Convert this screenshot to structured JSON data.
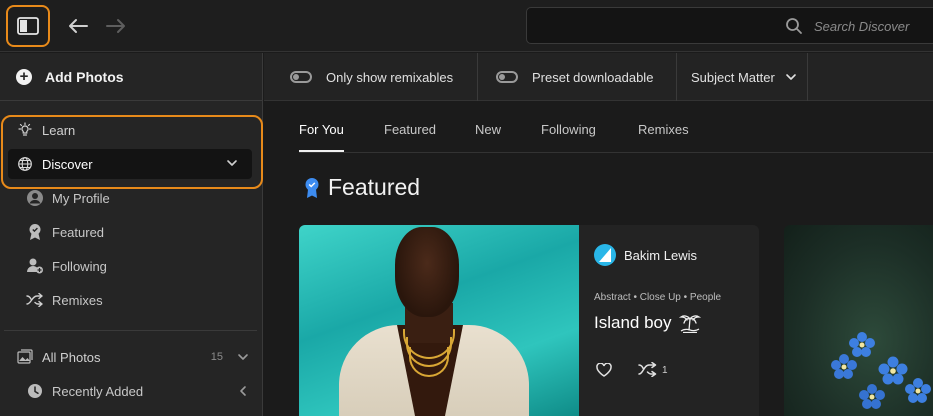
{
  "topbar": {
    "search_placeholder": "Search Discover"
  },
  "sidebar": {
    "add_photos": "Add Photos",
    "learn": "Learn",
    "discover": "Discover",
    "my_profile": "My Profile",
    "featured": "Featured",
    "following": "Following",
    "remixes": "Remixes",
    "all_photos": "All Photos",
    "all_photos_count": "15",
    "recently_added": "Recently Added"
  },
  "filters": {
    "remixables": "Only show remixables",
    "preset": "Preset downloadable",
    "subject": "Subject Matter"
  },
  "tabs": [
    "For You",
    "Featured",
    "New",
    "Following",
    "Remixes"
  ],
  "section_title": "Featured",
  "card": {
    "author": "Bakim Lewis",
    "tags": "Abstract • Close Up • People",
    "title": "Island boy",
    "remix_count": "1"
  },
  "colors": {
    "accent_highlight": "#e88a1a",
    "featured_badge": "#3d8cf0",
    "avatar": "#29b6e8"
  }
}
